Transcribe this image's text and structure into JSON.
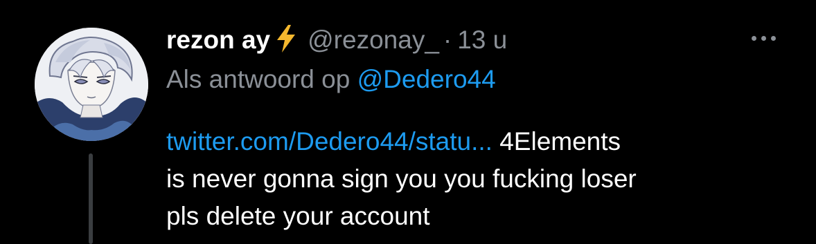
{
  "tweet": {
    "display_name": "rezon ay",
    "verified_emoji": "lightning-icon",
    "handle": "@rezonay_",
    "separator": "·",
    "time": "13 u",
    "reply_prefix": "Als antwoord op",
    "reply_mention": "@Dedero44",
    "link_text": "twitter.com/Dedero44/statu...",
    "text_line1": " 4Elements",
    "text_line2": "is never gonna sign you you fucking loser",
    "text_line3": "pls delete your account"
  },
  "colors": {
    "background": "#000000",
    "link": "#1d9bf0",
    "secondary_text": "#8b9097",
    "primary_text": "#ffffff"
  }
}
